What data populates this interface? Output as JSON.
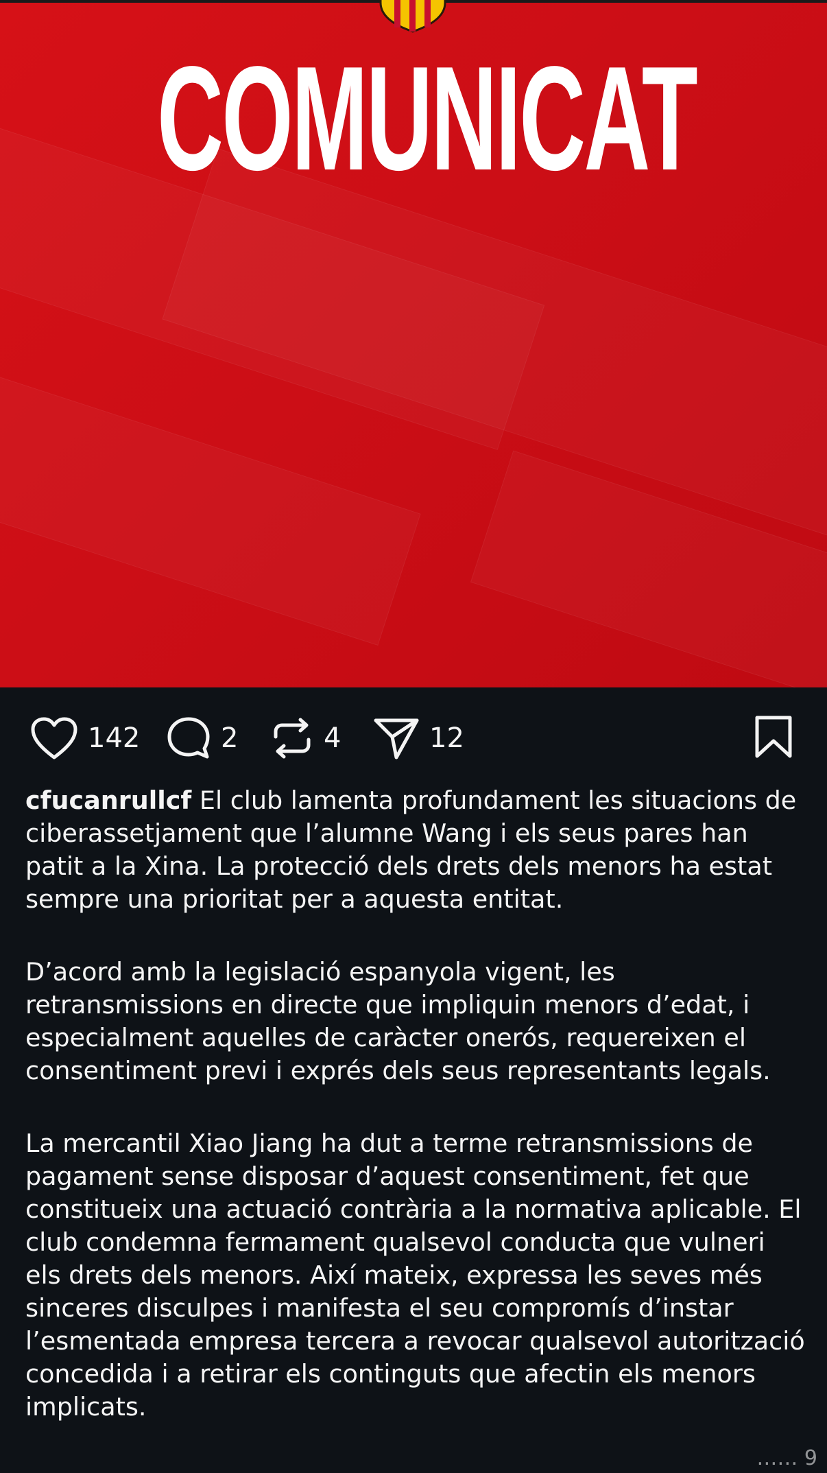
{
  "post": {
    "image_title": "COMUNICAT",
    "username": "cfucanrullcf",
    "paragraphs": [
      "El club lamenta profundament les situacions de ciberassetjament que l’alumne Wang i els seus pares han patit a la Xina. La protecció dels drets dels menors ha estat sempre una prioritat per a aquesta entitat.",
      "D’acord amb la legislació espanyola vigent, les retransmissions en directe que impliquin menors d’edat, i especialment aquelles de caràcter onerós, requereixen el consentiment previ i exprés dels seus representants legals.",
      "La mercantil Xiao Jiang ha dut a terme retransmissions de pagament sense disposar d’aquest consentiment, fet que constitueix una actuació contrària a la normativa aplicable. El club condemna fermament qualsevol conducta que vulneri els drets dels menors. Així mateix, expressa les seves més sinceres disculpes i manifesta el seu compromís d’instar l’esmentada empresa tercera a revocar qualsevol autorització concedida i a retirar els continguts que afectin els menors implicats."
    ]
  },
  "actions": {
    "likes": "142",
    "comments": "2",
    "reposts": "4",
    "shares": "12",
    "icons": [
      "heart-icon",
      "comment-icon",
      "repost-icon",
      "share-icon",
      "bookmark-icon"
    ]
  },
  "watermark": "…… 9",
  "colors": {
    "hero_red": "#cc0e16",
    "background": "#0e1217",
    "text": "#f4f4f4",
    "crest_yellow": "#f5c400"
  }
}
